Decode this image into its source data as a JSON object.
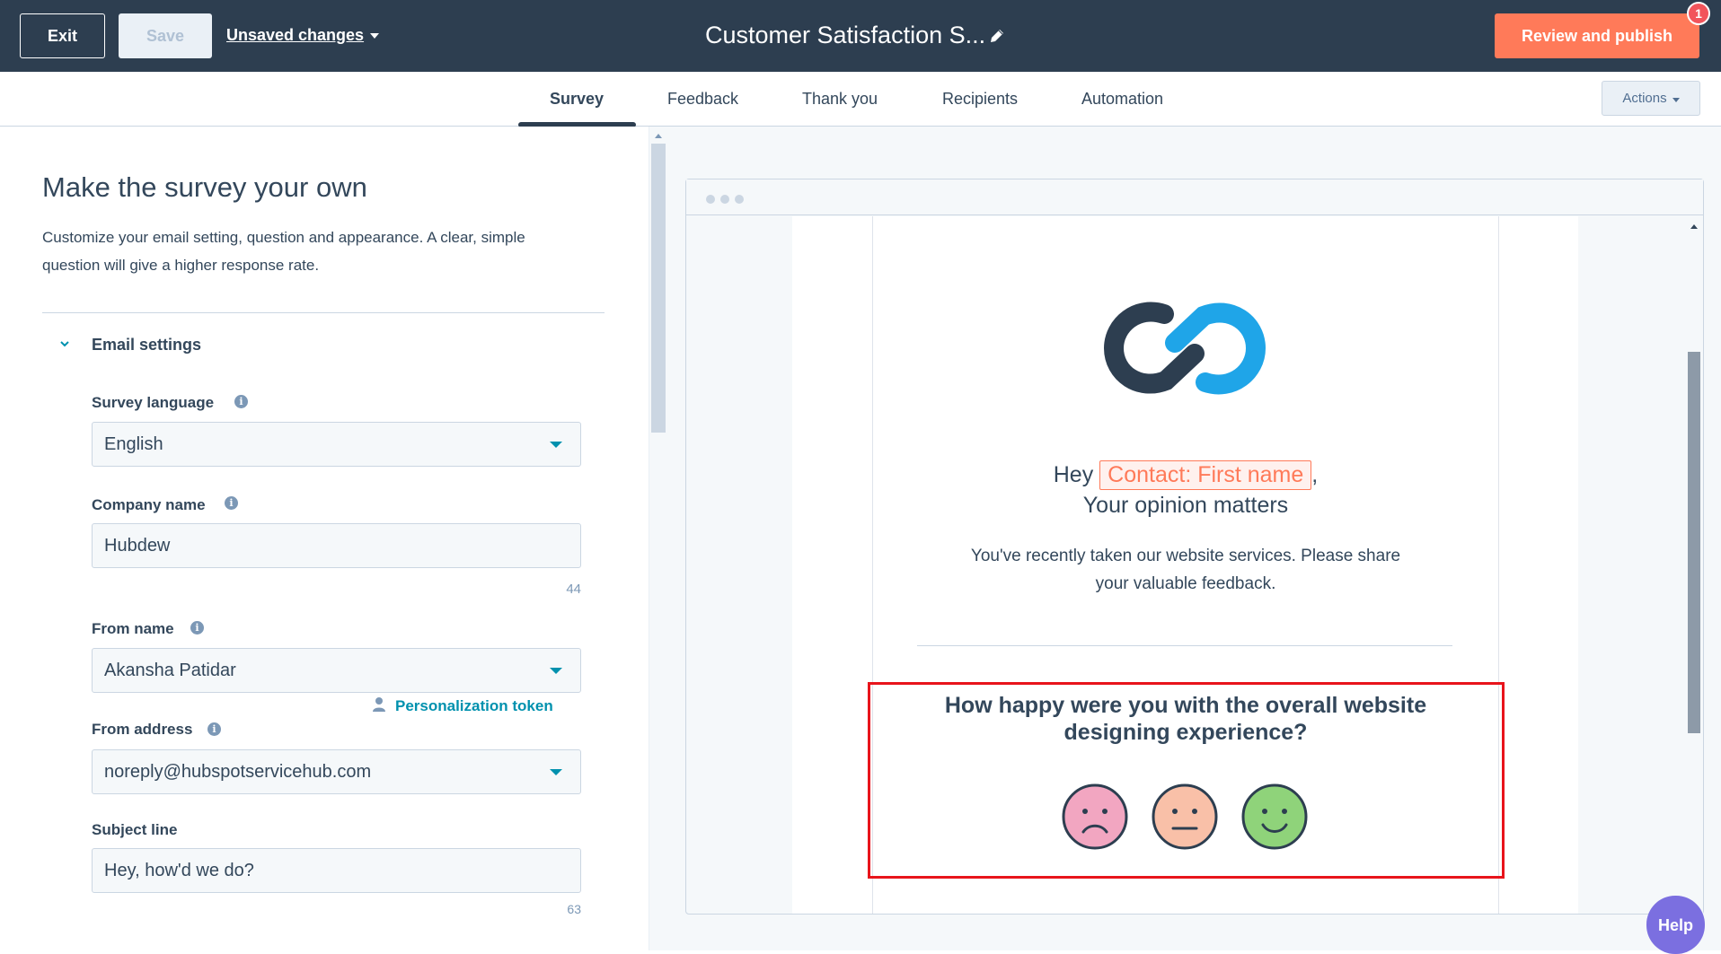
{
  "topbar": {
    "exit_label": "Exit",
    "save_label": "Save",
    "unsaved_label": "Unsaved changes",
    "title": "Customer Satisfaction S...",
    "review_label": "Review and publish",
    "notification_count": "1"
  },
  "tabs": [
    {
      "label": "Survey",
      "active": true
    },
    {
      "label": "Feedback",
      "active": false
    },
    {
      "label": "Thank you",
      "active": false
    },
    {
      "label": "Recipients",
      "active": false
    },
    {
      "label": "Automation",
      "active": false
    }
  ],
  "actions_label": "Actions",
  "left_panel": {
    "title": "Make the survey your own",
    "description": "Customize your email setting, question and appearance. A clear, simple question will give a higher response rate.",
    "section_title": "Email settings",
    "fields": {
      "survey_language": {
        "label": "Survey language",
        "value": "English"
      },
      "company_name": {
        "label": "Company name",
        "value": "Hubdew",
        "count": "44"
      },
      "from_name": {
        "label": "From name",
        "value": "Akansha Patidar"
      },
      "from_address": {
        "label": "From address",
        "value": "noreply@hubspotservicehub.com"
      },
      "subject_line": {
        "label": "Subject line",
        "value": "Hey, how'd we do?",
        "count": "63"
      }
    },
    "personalization_token_label": "Personalization token"
  },
  "preview": {
    "greeting_prefix": "Hey",
    "token": "Contact: First name",
    "greeting_suffix": ",",
    "subheading": "Your opinion matters",
    "body": "You've recently taken our website services. Please share your valuable feedback.",
    "question": "How happy were you with the overall website designing experience?",
    "faces": [
      "sad-face",
      "neutral-face",
      "happy-face"
    ]
  },
  "help_label": "Help",
  "colors": {
    "topbar": "#2d3e50",
    "accent_orange": "#ff7a59",
    "teal": "#0091ae",
    "highlight_red": "#e8141b",
    "sad_face": "#f2a6c1",
    "neutral_face": "#f9c0a8",
    "happy_face": "#8fd37a"
  }
}
